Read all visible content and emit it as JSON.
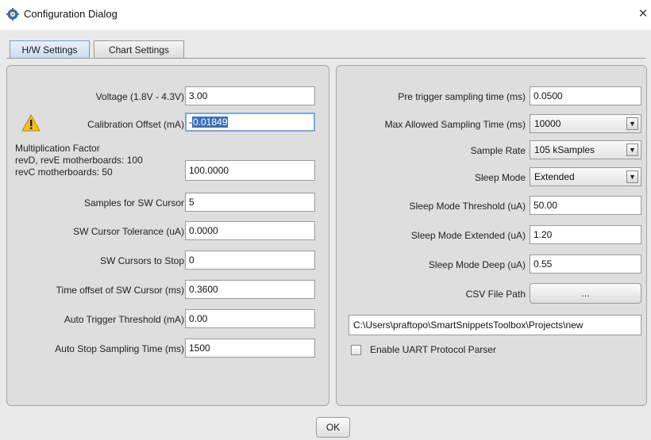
{
  "window": {
    "title": "Configuration Dialog",
    "close_glyph": "×",
    "icon": "gear-icon"
  },
  "tabs": [
    {
      "label": "H/W Settings",
      "active": true
    },
    {
      "label": "Chart Settings",
      "active": false
    }
  ],
  "left": {
    "voltage": {
      "label": "Voltage (1.8V - 4.3V)",
      "value": "3.00"
    },
    "calibration": {
      "label": "Calibration Offset (mA)",
      "value_prefix": "-",
      "value_selected": "0.01849",
      "icon": "warning-icon"
    },
    "multiplication": {
      "line1": "Multiplication Factor",
      "line2": "revD, revE motherboards: 100",
      "line3": "revC motherboards: 50",
      "value": "100.0000"
    },
    "samples_sw_cursor": {
      "label": "Samples for SW Cursor",
      "value": "5"
    },
    "sw_cursor_tolerance": {
      "label": "SW Cursor Tolerance (uA)",
      "value": "0.0000"
    },
    "sw_cursors_to_stop": {
      "label": "SW Cursors to Stop",
      "value": "0"
    },
    "time_offset": {
      "label": "Time offset of SW Cursor (ms)",
      "value": "0.3600"
    },
    "auto_trigger": {
      "label": "Auto Trigger Threshold (mA)",
      "value": "0.00"
    },
    "auto_stop": {
      "label": "Auto Stop Sampling Time (ms)",
      "value": "1500"
    }
  },
  "right": {
    "pre_trigger": {
      "label": "Pre trigger sampling time (ms)",
      "value": "0.0500"
    },
    "max_sampling": {
      "label": "Max Allowed Sampling Time (ms)",
      "value": "10000"
    },
    "sample_rate": {
      "label": "Sample Rate",
      "value": "105 kSamples"
    },
    "sleep_mode": {
      "label": "Sleep Mode",
      "value": "Extended"
    },
    "sleep_threshold": {
      "label": "Sleep Mode Threshold (uA)",
      "value": "50.00"
    },
    "sleep_extended": {
      "label": "Sleep Mode Extended (uA)",
      "value": "1.20"
    },
    "sleep_deep": {
      "label": "Sleep Mode Deep (uA)",
      "value": "0.55"
    },
    "csv": {
      "label": "CSV File Path",
      "button": "...",
      "path": "C:\\Users\\praftopo\\SmartSnippetsToolbox\\Projects\\new"
    },
    "uart": {
      "label": "Enable UART Protocol Parser",
      "checked": false
    }
  },
  "footer": {
    "ok_label": "OK"
  },
  "colors": {
    "selection": "#3d6fb6",
    "focus_border": "#7ea7d8",
    "warning": "#f2c01e"
  }
}
